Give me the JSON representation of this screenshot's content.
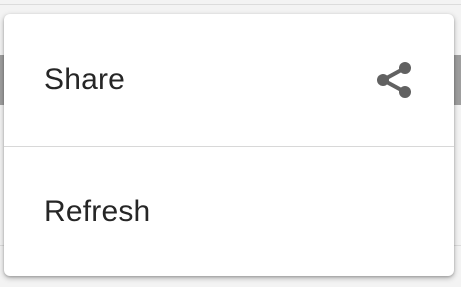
{
  "menu": {
    "items": [
      {
        "label": "Share",
        "icon": "share-icon"
      },
      {
        "label": "Refresh"
      }
    ]
  },
  "colors": {
    "text": "#262626",
    "icon": "#616161",
    "divider": "#d8d8d8",
    "popup_background": "#ffffff"
  }
}
